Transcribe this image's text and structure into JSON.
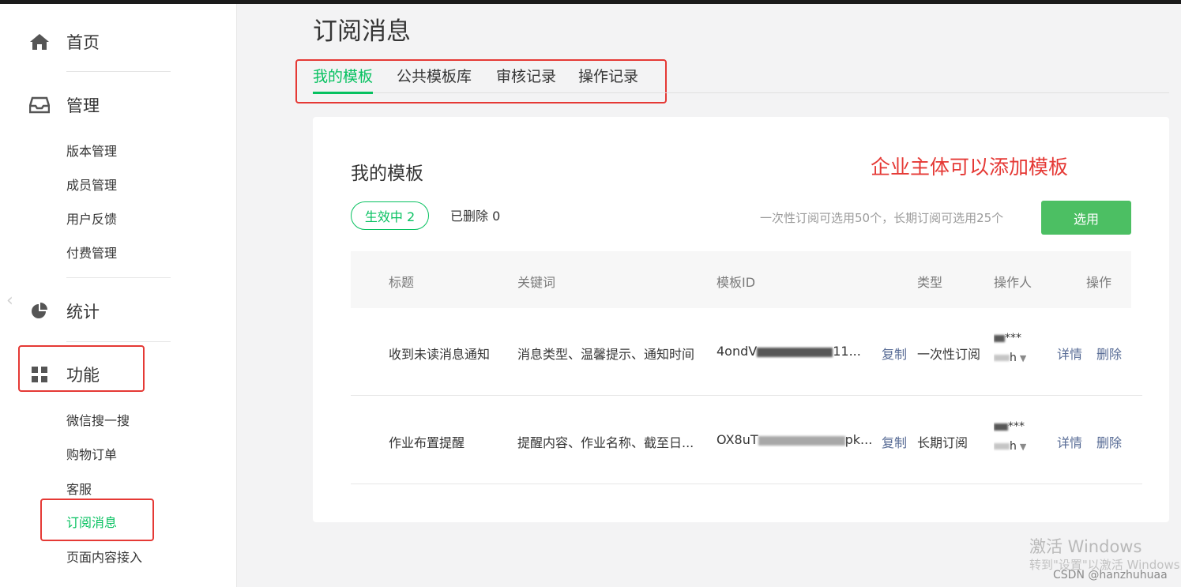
{
  "sidebar": {
    "home": "首页",
    "manage": "管理",
    "manage_items": [
      "版本管理",
      "成员管理",
      "用户反馈",
      "付费管理"
    ],
    "stats": "统计",
    "features": "功能",
    "feature_items": [
      "微信搜一搜",
      "购物订单",
      "客服",
      "订阅消息",
      "页面内容接入"
    ],
    "active_item": "订阅消息"
  },
  "page": {
    "title": "订阅消息",
    "tabs": [
      "我的模板",
      "公共模板库",
      "审核记录",
      "操作记录"
    ],
    "active_tab": "我的模板"
  },
  "card": {
    "title": "我的模板",
    "annotation": "企业主体可以添加模板",
    "filter_active": "生效中 2",
    "filter_deleted": "已删除 0",
    "quota": "一次性订阅可选用50个，长期订阅可选用25个",
    "select_button": "选用"
  },
  "table": {
    "columns": [
      "标题",
      "关键词",
      "模板ID",
      "类型",
      "操作人",
      "操作"
    ],
    "rows": [
      {
        "title": "收到未读消息通知",
        "keywords": "消息类型、温馨提示、通知时间",
        "template_id_visible": "4ondV",
        "template_id_tail": "11...",
        "copy": "复制",
        "type": "一次性订阅",
        "operator_stars": "***",
        "operator_tail": "h",
        "details": "详情",
        "delete": "删除"
      },
      {
        "title": "作业布置提醒",
        "keywords": "提醒内容、作业名称、截至日...",
        "template_id_visible": "OX8uT",
        "template_id_tail": "pk...",
        "copy": "复制",
        "type": "长期订阅",
        "operator_stars": "***",
        "operator_tail": "h",
        "details": "详情",
        "delete": "删除"
      }
    ]
  },
  "watermark": {
    "line1": "激活 Windows",
    "line2": "转到\"设置\"以激活 Windows",
    "credit": "CSDN @hanzhuhuaa"
  },
  "colors": {
    "accent": "#07c160",
    "button": "#4cbf63",
    "link": "#576b95",
    "annotation_red": "#e53935"
  }
}
